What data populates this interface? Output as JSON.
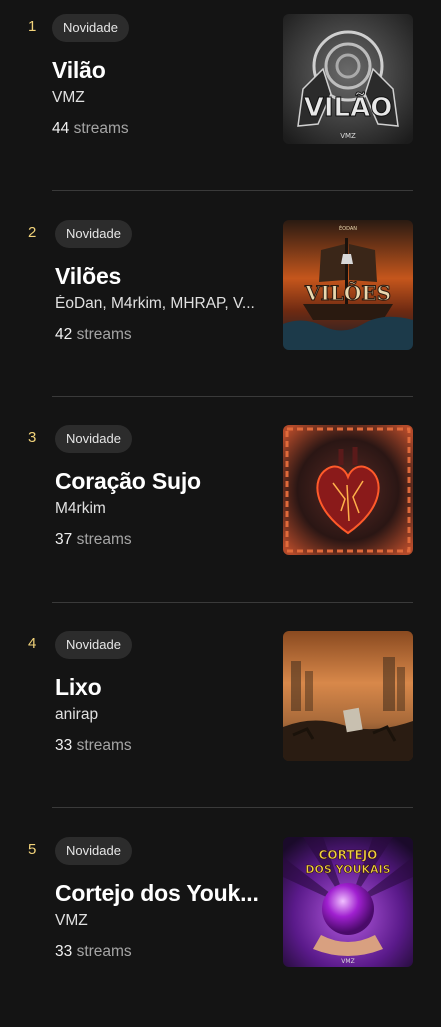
{
  "entries": [
    {
      "rank": "1",
      "badge": "Novidade",
      "title": "Vilão",
      "artist": "VMZ",
      "streams": "44",
      "streams_label": "streams",
      "cover_icon": "album-cover-vilao"
    },
    {
      "rank": "2",
      "badge": "Novidade",
      "title": "Vilões",
      "artist": "ÉoDan, M4rkim, MHRAP, V...",
      "streams": "42",
      "streams_label": "streams",
      "cover_icon": "album-cover-viloes"
    },
    {
      "rank": "3",
      "badge": "Novidade",
      "title": "Coração Sujo",
      "artist": "M4rkim",
      "streams": "37",
      "streams_label": "streams",
      "cover_icon": "album-cover-coracao-sujo"
    },
    {
      "rank": "4",
      "badge": "Novidade",
      "title": "Lixo",
      "artist": "anirap",
      "streams": "33",
      "streams_label": "streams",
      "cover_icon": "album-cover-lixo"
    },
    {
      "rank": "5",
      "badge": "Novidade",
      "title": "Cortejo dos Youk...",
      "artist": "VMZ",
      "streams": "33",
      "streams_label": "streams",
      "cover_icon": "album-cover-cortejo"
    }
  ],
  "colors": {
    "background": "#141414",
    "rank": "#f2d37a",
    "badge_bg": "#2c2c2c",
    "divider": "#3a3a3a"
  }
}
